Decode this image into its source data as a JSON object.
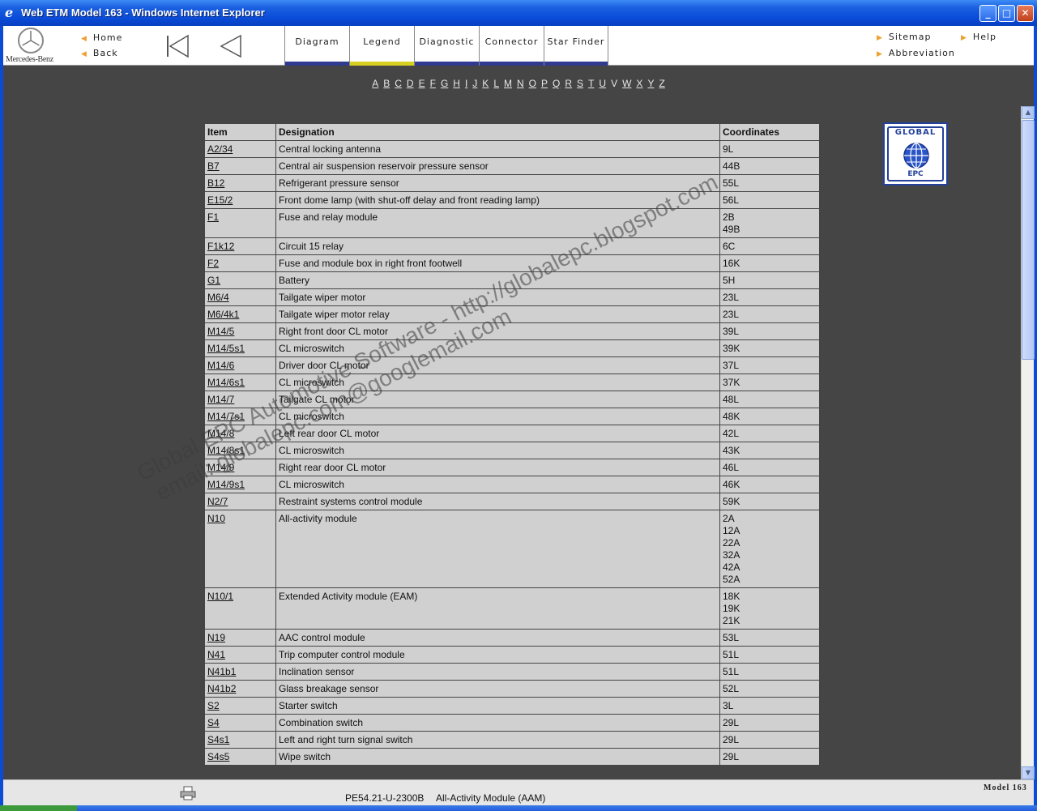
{
  "window": {
    "title": "Web ETM Model 163 - Windows Internet Explorer"
  },
  "nav": {
    "brand": "Mercedes-Benz",
    "home": "Home",
    "back": "Back",
    "sitemap": "Sitemap",
    "help": "Help",
    "abbreviation": "Abbreviation",
    "tabs": [
      "Diagram",
      "Legend",
      "Diagnostic",
      "Connector",
      "Star Finder"
    ],
    "active_tab": "Legend"
  },
  "alphabet": [
    "A",
    "B",
    "C",
    "D",
    "E",
    "F",
    "G",
    "H",
    "I",
    "J",
    "K",
    "L",
    "M",
    "N",
    "O",
    "P",
    "Q",
    "R",
    "S",
    "T",
    "U",
    "V",
    "W",
    "X",
    "Y",
    "Z"
  ],
  "logo": {
    "line1": "GLOBAL",
    "line2": "EPC"
  },
  "table": {
    "headers": [
      "Item",
      "Designation",
      "Coordinates"
    ],
    "rows": [
      {
        "item": "A2/34",
        "designation": "Central locking antenna",
        "coords": [
          "9L"
        ]
      },
      {
        "item": "B7",
        "designation": "Central air suspension reservoir pressure sensor",
        "coords": [
          "44B"
        ]
      },
      {
        "item": "B12",
        "designation": "Refrigerant pressure sensor",
        "coords": [
          "55L"
        ]
      },
      {
        "item": "E15/2",
        "designation": "Front dome lamp (with shut-off delay and front reading lamp)",
        "coords": [
          "56L"
        ]
      },
      {
        "item": "F1",
        "designation": "Fuse and relay module",
        "coords": [
          "2B",
          "49B"
        ]
      },
      {
        "item": "F1k12",
        "designation": "Circuit 15 relay",
        "coords": [
          "6C"
        ]
      },
      {
        "item": "F2",
        "designation": "Fuse and module box in right front footwell",
        "coords": [
          "16K"
        ]
      },
      {
        "item": "G1",
        "designation": "Battery",
        "coords": [
          "5H"
        ]
      },
      {
        "item": "M6/4",
        "designation": "Tailgate wiper motor",
        "coords": [
          "23L"
        ]
      },
      {
        "item": "M6/4k1",
        "designation": "Tailgate wiper motor relay",
        "coords": [
          "23L"
        ]
      },
      {
        "item": "M14/5",
        "designation": "Right front door CL motor",
        "coords": [
          "39L"
        ]
      },
      {
        "item": "M14/5s1",
        "designation": "CL microswitch",
        "coords": [
          "39K"
        ]
      },
      {
        "item": "M14/6",
        "designation": "Driver door CL motor",
        "coords": [
          "37L"
        ]
      },
      {
        "item": "M14/6s1",
        "designation": "CL microswitch",
        "coords": [
          "37K"
        ]
      },
      {
        "item": "M14/7",
        "designation": "Tailgate CL motor",
        "coords": [
          "48L"
        ]
      },
      {
        "item": "M14/7s1",
        "designation": "CL microswitch",
        "coords": [
          "48K"
        ]
      },
      {
        "item": "M14/8",
        "designation": "Left rear door CL motor",
        "coords": [
          "42L"
        ]
      },
      {
        "item": "M14/8s1",
        "designation": "CL microswitch",
        "coords": [
          "43K"
        ]
      },
      {
        "item": "M14/9",
        "designation": "Right rear door CL motor",
        "coords": [
          "46L"
        ]
      },
      {
        "item": "M14/9s1",
        "designation": "CL microswitch",
        "coords": [
          "46K"
        ]
      },
      {
        "item": "N2/7",
        "designation": "Restraint systems control module",
        "coords": [
          "59K"
        ]
      },
      {
        "item": "N10",
        "designation": "All-activity module",
        "coords": [
          "2A",
          "12A",
          "22A",
          "32A",
          "42A",
          "52A"
        ]
      },
      {
        "item": "N10/1",
        "designation": "Extended Activity module (EAM)",
        "coords": [
          "18K",
          "19K",
          "21K"
        ]
      },
      {
        "item": "N19",
        "designation": "AAC control module",
        "coords": [
          "53L"
        ]
      },
      {
        "item": "N41",
        "designation": "Trip computer control module",
        "coords": [
          "51L"
        ]
      },
      {
        "item": "N41b1",
        "designation": "Inclination sensor",
        "coords": [
          "51L"
        ]
      },
      {
        "item": "N41b2",
        "designation": "Glass breakage sensor",
        "coords": [
          "52L"
        ]
      },
      {
        "item": "S2",
        "designation": "Starter switch",
        "coords": [
          "3L"
        ]
      },
      {
        "item": "S4",
        "designation": "Combination switch",
        "coords": [
          "29L"
        ]
      },
      {
        "item": "S4s1",
        "designation": "Left and right turn signal switch",
        "coords": [
          "29L"
        ]
      },
      {
        "item": "S4s5",
        "designation": "Wipe switch",
        "coords": [
          "29L"
        ]
      }
    ]
  },
  "status": {
    "doc_id": "PE54.21-U-2300B",
    "doc_title": "All-Activity Module (AAM)",
    "model": "Model 163"
  },
  "watermark": {
    "line1": "Global EPC Automotive Software - http://globalepc.blogspot.com",
    "line2": "email: globalepc.com@googlemail.com"
  }
}
